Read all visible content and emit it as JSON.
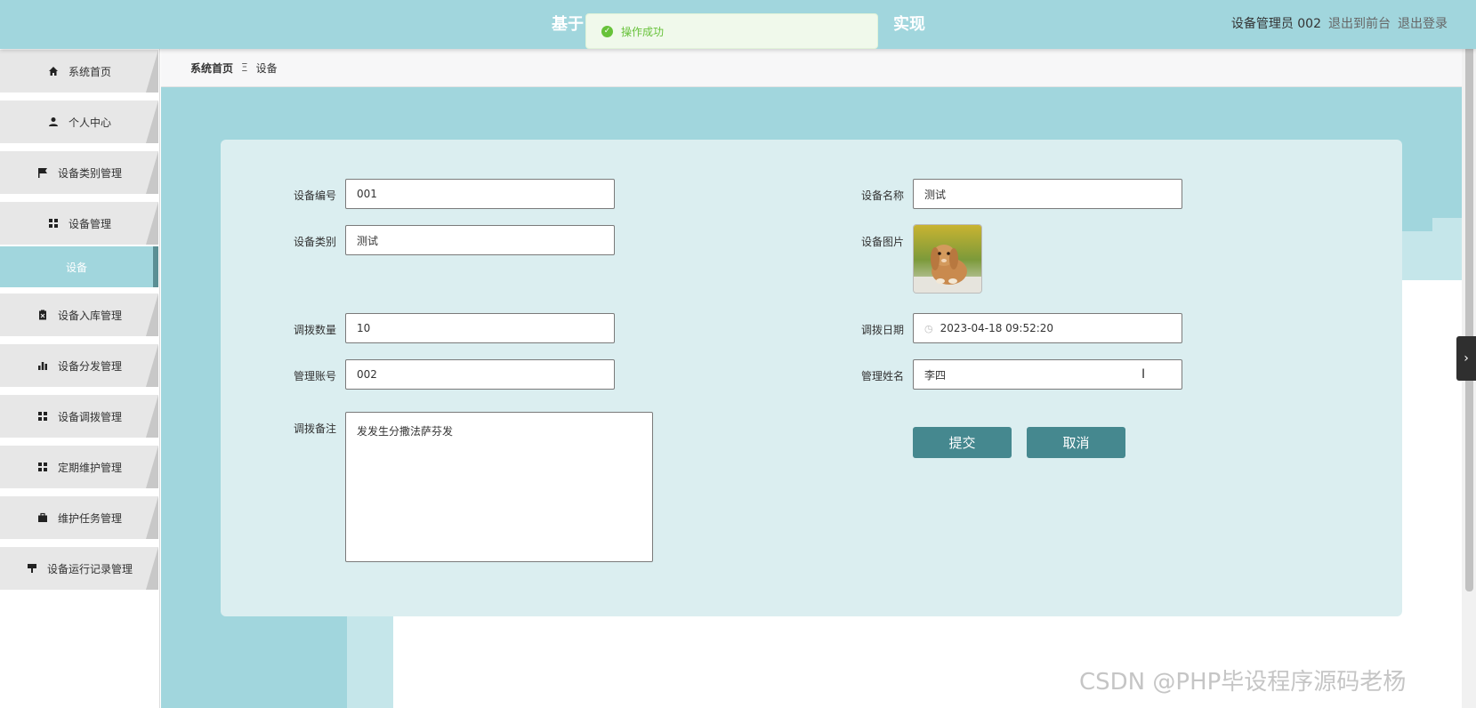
{
  "header": {
    "title": "基于",
    "title_tail": "实现",
    "user": "设备管理员 002",
    "to_front": "退出到前台",
    "logout": "退出登录"
  },
  "toast": {
    "message": "操作成功"
  },
  "sidebar": {
    "items": [
      {
        "label": "系统首页",
        "icon": "home-icon"
      },
      {
        "label": "个人中心",
        "icon": "user-icon"
      },
      {
        "label": "设备类别管理",
        "icon": "flag-icon"
      },
      {
        "label": "设备管理",
        "icon": "grid-icon"
      },
      {
        "label": "设备入库管理",
        "icon": "clipboard-icon"
      },
      {
        "label": "设备分发管理",
        "icon": "bar-chart-icon"
      },
      {
        "label": "设备调拨管理",
        "icon": "grid-icon"
      },
      {
        "label": "定期维护管理",
        "icon": "grid-icon"
      },
      {
        "label": "维护任务管理",
        "icon": "briefcase-icon"
      },
      {
        "label": "设备运行记录管理",
        "icon": "sign-icon"
      }
    ],
    "active_sub": "设备"
  },
  "breadcrumb": {
    "home": "系统首页",
    "sep": "Ξ",
    "current": "设备"
  },
  "form": {
    "code_label": "设备编号",
    "code_value": "001",
    "name_label": "设备名称",
    "name_value": "测试",
    "category_label": "设备类别",
    "category_value": "测试",
    "image_label": "设备图片",
    "qty_label": "调拨数量",
    "qty_value": "10",
    "date_label": "调拨日期",
    "date_value": "2023-04-18 09:52:20",
    "account_label": "管理账号",
    "account_value": "002",
    "manager_label": "管理姓名",
    "manager_value": "李四",
    "remark_label": "调拨备注",
    "remark_value": "发发生分撒法萨芬发",
    "submit": "提交",
    "cancel": "取消"
  },
  "watermark": "CSDN @PHP毕设程序源码老杨",
  "colors": {
    "header": "#a1d6dd",
    "button": "#45888f",
    "card": "#dbeef0",
    "toast_text": "#67c23a"
  }
}
